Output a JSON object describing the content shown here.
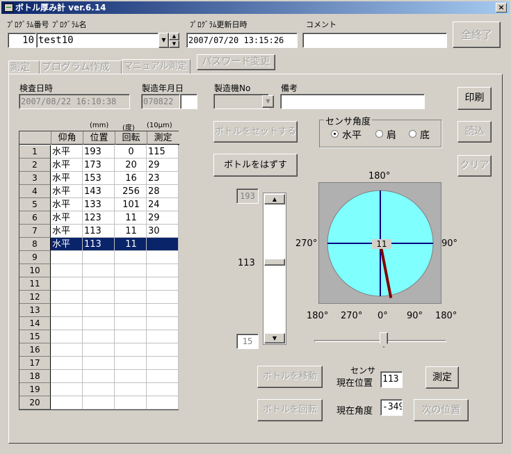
{
  "window": {
    "title": "ボトル厚み計 ver.6.14",
    "close_glyph": "×"
  },
  "header": {
    "program_no_label": "ﾌﾟﾛｸﾞﾗﾑ番号",
    "program_name_label": "ﾌﾟﾛｸﾞﾗﾑ名",
    "update_label": "ﾌﾟﾛｸﾞﾗﾑ更新日時",
    "comment_label": "コメント",
    "program_no": "10",
    "program_name": "test10",
    "update_datetime": "2007/07/20 13:15:26",
    "comment": "",
    "exit_label": "全終了"
  },
  "tabs": [
    "測定",
    "プログラム作成",
    "マニュアル測定"
  ],
  "password_label": "パスワード変更",
  "info": {
    "inspect_label": "検査日時",
    "inspect_value": "2007/08/22 16:10:38",
    "mfg_date_label": "製造年月日",
    "mfg_date_value": "070822",
    "machine_label": "製造機No",
    "machine_value": "",
    "note_label": "備考",
    "note_value": ""
  },
  "buttons": {
    "print": "印刷",
    "read": "読込",
    "clear": "クリア",
    "set_bottle": "ボトルをセットする",
    "remove_bottle": "ボトルをはずす",
    "move_bottle": "ボトルを移動",
    "rotate_bottle": "ボトルを回転",
    "measure": "測定",
    "next_pos": "次の位置"
  },
  "sensor": {
    "group_label": "センサ角度",
    "options": [
      "水平",
      "肩",
      "底"
    ],
    "selected": 0
  },
  "table": {
    "units": [
      "(mm)",
      "(度)",
      "(10μm)"
    ],
    "headers": [
      "仰角",
      "位置",
      "回転",
      "測定"
    ],
    "rows": [
      [
        "水平",
        "193",
        "0",
        "115"
      ],
      [
        "水平",
        "173",
        "20",
        "29"
      ],
      [
        "水平",
        "153",
        "16",
        "23"
      ],
      [
        "水平",
        "143",
        "256",
        "28"
      ],
      [
        "水平",
        "133",
        "101",
        "24"
      ],
      [
        "水平",
        "123",
        "11",
        "29"
      ],
      [
        "水平",
        "113",
        "11",
        "30"
      ],
      [
        "水平",
        "113",
        "11",
        ""
      ]
    ],
    "row_numbers": [
      "1",
      "2",
      "3",
      "4",
      "5",
      "6",
      "7",
      "8",
      "9",
      "10",
      "11",
      "12",
      "13",
      "14",
      "15",
      "16",
      "17",
      "18",
      "19",
      "20"
    ],
    "selected_row": 7
  },
  "scroll": {
    "top_value": "193",
    "current": "113",
    "bottom_value": "15"
  },
  "dial": {
    "top": "180°",
    "left": "270°",
    "right": "90°",
    "center_value": "11",
    "needle_deg": -11
  },
  "angle_scale": [
    "180°",
    "270°",
    "0°",
    "90°",
    "180°"
  ],
  "status": {
    "sensor_label": "センサ",
    "pos_label": "現在位置",
    "pos_value": "113",
    "angle_label": "現在角度",
    "angle_value": "-349"
  }
}
